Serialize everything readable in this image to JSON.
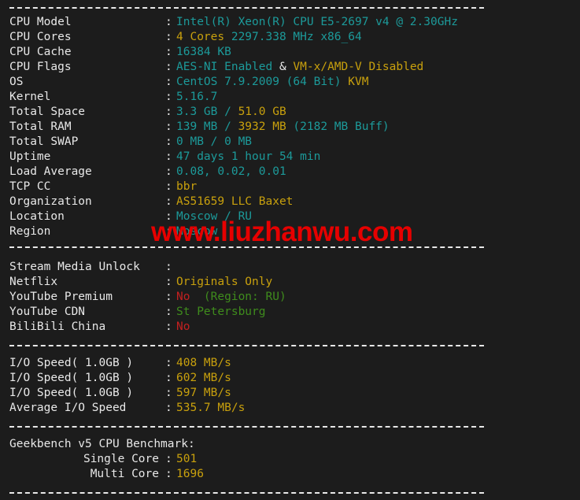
{
  "terminal": {
    "background_color": "#1c1c1c",
    "watermark_text": "www.liuzhanwu.com",
    "watermark_color": "#e60000",
    "separator_char": "-"
  },
  "colors": {
    "label": "#e8e8e8",
    "cyan": "#1c9a9a",
    "yellow": "#c8a00d",
    "green": "#3f8c1c",
    "red": "#c42020"
  },
  "system_info": {
    "rows": [
      {
        "label": "CPU Model",
        "parts": [
          {
            "text": "Intel(R) Xeon(R) CPU E5-2697 v4 @ 2.30GHz",
            "color": "cyan"
          }
        ]
      },
      {
        "label": "CPU Cores",
        "parts": [
          {
            "text": "4 Cores",
            "color": "yellow"
          },
          {
            "text": " 2297.338 MHz x86_64",
            "color": "cyan"
          }
        ]
      },
      {
        "label": "CPU Cache",
        "parts": [
          {
            "text": "16384 KB",
            "color": "cyan"
          }
        ]
      },
      {
        "label": "CPU Flags",
        "parts": [
          {
            "text": "AES-NI Enabled",
            "color": "cyan"
          },
          {
            "text": " & ",
            "color": "white"
          },
          {
            "text": "VM-x/AMD-V Disabled",
            "color": "yellow"
          }
        ]
      },
      {
        "label": "OS",
        "parts": [
          {
            "text": "CentOS 7.9.2009 (64 Bit) ",
            "color": "cyan"
          },
          {
            "text": "KVM",
            "color": "yellow"
          }
        ]
      },
      {
        "label": "Kernel",
        "parts": [
          {
            "text": "5.16.7",
            "color": "cyan"
          }
        ]
      },
      {
        "label": "Total Space",
        "parts": [
          {
            "text": "3.3 GB ",
            "color": "cyan"
          },
          {
            "text": "/ ",
            "color": "cyan"
          },
          {
            "text": "51.0 GB",
            "color": "yellow"
          }
        ]
      },
      {
        "label": "Total RAM",
        "parts": [
          {
            "text": "139 MB ",
            "color": "cyan"
          },
          {
            "text": "/ ",
            "color": "cyan"
          },
          {
            "text": "3932 MB ",
            "color": "yellow"
          },
          {
            "text": "(2182 MB Buff)",
            "color": "cyan"
          }
        ]
      },
      {
        "label": "Total SWAP",
        "parts": [
          {
            "text": "0 MB / 0 MB",
            "color": "cyan"
          }
        ]
      },
      {
        "label": "Uptime",
        "parts": [
          {
            "text": "47 days 1 hour 54 min",
            "color": "cyan"
          }
        ]
      },
      {
        "label": "Load Average",
        "parts": [
          {
            "text": "0.08, 0.02, 0.01",
            "color": "cyan"
          }
        ]
      },
      {
        "label": "TCP CC",
        "parts": [
          {
            "text": "bbr",
            "color": "yellow"
          }
        ]
      },
      {
        "label": "Organization",
        "parts": [
          {
            "text": "AS51659 LLC Baxet",
            "color": "yellow"
          }
        ]
      },
      {
        "label": "Location",
        "parts": [
          {
            "text": "Moscow / RU",
            "color": "cyan"
          }
        ]
      },
      {
        "label": "Region",
        "parts": [
          {
            "text": "Moscow",
            "color": "cyan"
          }
        ]
      }
    ]
  },
  "stream_media": {
    "heading": "Stream Media Unlock",
    "rows": [
      {
        "label": "Netflix",
        "parts": [
          {
            "text": "Originals Only",
            "color": "yellow"
          }
        ]
      },
      {
        "label": "YouTube Premium",
        "parts": [
          {
            "text": "No",
            "color": "red"
          },
          {
            "text": "  (Region: RU)",
            "color": "green"
          }
        ]
      },
      {
        "label": "YouTube CDN",
        "parts": [
          {
            "text": "St Petersburg",
            "color": "green"
          }
        ]
      },
      {
        "label": "BiliBili China",
        "parts": [
          {
            "text": "No",
            "color": "red"
          }
        ]
      }
    ]
  },
  "io_speed": {
    "rows": [
      {
        "label": "I/O Speed( 1.0GB )",
        "parts": [
          {
            "text": "408 MB/s",
            "color": "yellow"
          }
        ]
      },
      {
        "label": "I/O Speed( 1.0GB )",
        "parts": [
          {
            "text": "602 MB/s",
            "color": "yellow"
          }
        ]
      },
      {
        "label": "I/O Speed( 1.0GB )",
        "parts": [
          {
            "text": "597 MB/s",
            "color": "yellow"
          }
        ]
      },
      {
        "label": "Average I/O Speed",
        "parts": [
          {
            "text": "535.7 MB/s",
            "color": "yellow"
          }
        ]
      }
    ]
  },
  "geekbench": {
    "heading": "Geekbench v5 CPU Benchmark:",
    "rows": [
      {
        "label": "Single Core",
        "parts": [
          {
            "text": "501",
            "color": "yellow"
          }
        ]
      },
      {
        "label": "Multi Core",
        "parts": [
          {
            "text": "1696",
            "color": "yellow"
          }
        ]
      }
    ]
  }
}
